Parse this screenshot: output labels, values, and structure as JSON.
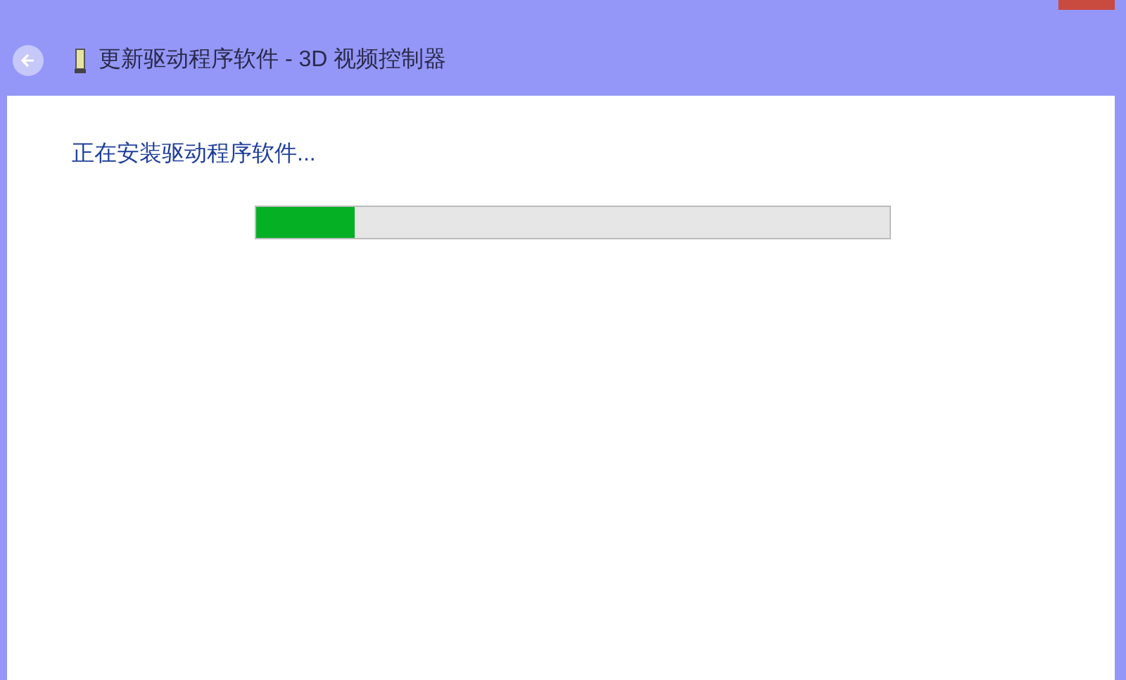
{
  "window": {
    "title": "更新驱动程序软件 - 3D 视频控制器"
  },
  "status": {
    "text": "正在安装驱动程序软件..."
  },
  "progress": {
    "level": 0.155
  }
}
